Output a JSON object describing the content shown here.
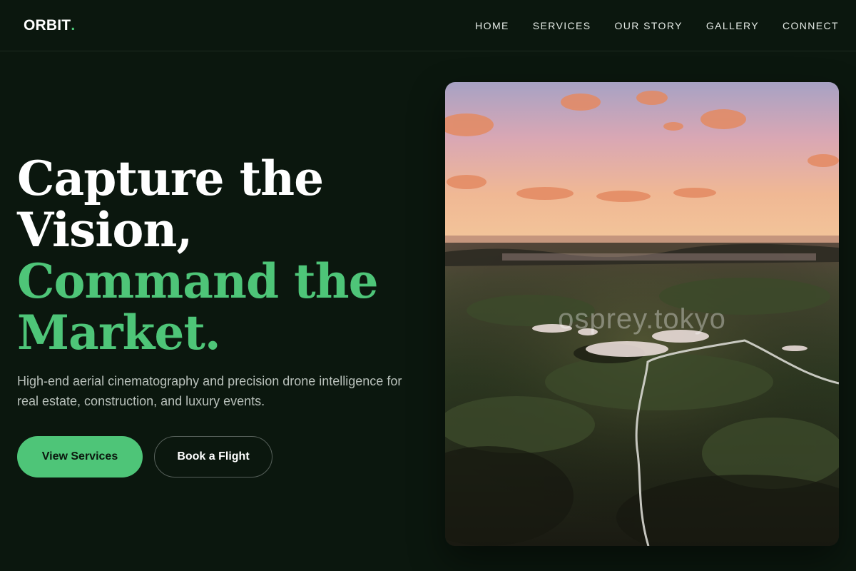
{
  "brand": {
    "name": "ORBIT",
    "dot": ".",
    "accent": "#4ec578"
  },
  "nav": {
    "items": [
      {
        "label": "HOME"
      },
      {
        "label": "SERVICES"
      },
      {
        "label": "OUR STORY"
      },
      {
        "label": "GALLERY"
      },
      {
        "label": "CONNECT"
      }
    ]
  },
  "hero": {
    "headline": {
      "line1": "Capture the",
      "line2": "Vision,",
      "line3": "Command the",
      "line4": "Market."
    },
    "subtext": "High-end aerial cinematography and precision drone intelligence for real estate, construction, and luxury events.",
    "primary_button": "View Services",
    "secondary_button": "Book a Flight",
    "image": {
      "subject": "aerial-wetland-sunset-photo",
      "watermark": "osprey.tokyo"
    }
  },
  "colors": {
    "background": "#0b170e",
    "accent": "#4ec578",
    "text": "#ffffff",
    "muted_text": "#b9c1bb"
  }
}
